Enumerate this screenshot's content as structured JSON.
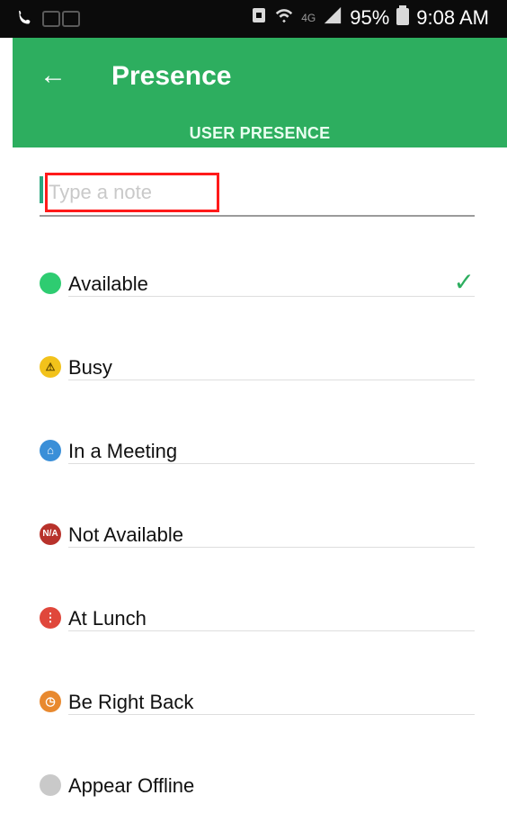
{
  "status_bar": {
    "battery": "95%",
    "time": "9:08 AM",
    "network_text": "4G"
  },
  "header": {
    "title": "Presence",
    "back_icon": "back-arrow-icon",
    "tab_label": "USER PRESENCE"
  },
  "note": {
    "placeholder": "Type a note",
    "value": ""
  },
  "presence": {
    "items": [
      {
        "label": "Available",
        "icon": "available-dot-icon",
        "color": "#2ecc71",
        "selected": true
      },
      {
        "label": "Busy",
        "icon": "busy-warning-icon",
        "color": "#f2c21b",
        "selected": false
      },
      {
        "label": "In a Meeting",
        "icon": "meeting-icon",
        "color": "#3a8fd8",
        "selected": false
      },
      {
        "label": "Not Available",
        "icon": "not-available-icon",
        "color": "#b8322b",
        "selected": false
      },
      {
        "label": "At Lunch",
        "icon": "lunch-icon",
        "color": "#e0473b",
        "selected": false
      },
      {
        "label": "Be Right Back",
        "icon": "be-right-back-icon",
        "color": "#e8892f",
        "selected": false
      },
      {
        "label": "Appear Offline",
        "icon": "offline-icon",
        "color": "#c9c9c9",
        "selected": false
      }
    ]
  },
  "colors": {
    "app_bar": "#2dae5f",
    "status_bar": "#0b0b0b",
    "highlight_box": "#ff1a1a"
  }
}
